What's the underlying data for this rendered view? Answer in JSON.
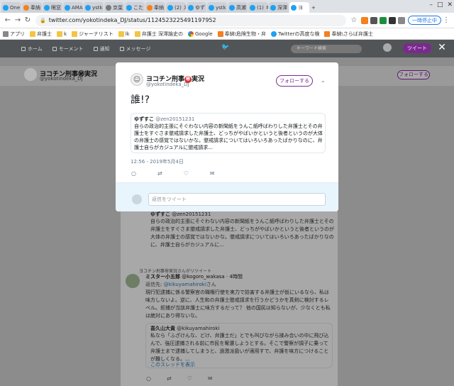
{
  "browser": {
    "tabs": [
      {
        "label": "One",
        "icon": "tw"
      },
      {
        "label": "奉納",
        "icon": "or"
      },
      {
        "label": "眼窓",
        "icon": "tw"
      },
      {
        "label": "AMA",
        "icon": "tw"
      },
      {
        "label": "ystk",
        "icon": "tw"
      },
      {
        "label": "京葉",
        "icon": "gr"
      },
      {
        "label": "こた",
        "icon": "tw"
      },
      {
        "label": "奉納",
        "icon": "or"
      },
      {
        "label": "(2) え",
        "icon": "tw"
      },
      {
        "label": "ゆず",
        "icon": "tw"
      },
      {
        "label": "ystk",
        "icon": "tw"
      },
      {
        "label": "高瀬",
        "icon": "tw"
      },
      {
        "label": "(1) キ",
        "icon": "tw"
      },
      {
        "label": "深澤",
        "icon": "tw"
      },
      {
        "label": "ヨ",
        "icon": "tw"
      }
    ],
    "url": "twitter.com/yokotindeka_DJ/status/1124523225491197952",
    "pause_label": "一時停止中",
    "bookmarks": [
      {
        "label": "アプリ",
        "icon": "lk"
      },
      {
        "label": "弁護士",
        "icon": "folder"
      },
      {
        "label": "k",
        "icon": "folder"
      },
      {
        "label": "ジャーナリスト",
        "icon": "folder"
      },
      {
        "label": "lk",
        "icon": "folder"
      },
      {
        "label": "弁護士 深澤論史の",
        "icon": "folder"
      },
      {
        "label": "Google",
        "icon": "g"
      },
      {
        "label": "奉納\\危険生物・弁",
        "icon": "or"
      },
      {
        "label": "Twitterの高度な検",
        "icon": "tw"
      },
      {
        "label": "奉納\\さらば弁護士",
        "icon": "or"
      }
    ]
  },
  "twitter_nav": {
    "home": "ホーム",
    "moments": "モーメント",
    "notifications": "通知",
    "messages": "メッセージ",
    "search_placeholder": "キーワード検索",
    "tweet_button": "ツイート"
  },
  "profile": {
    "name": "ヨコチン刑事㊙実況",
    "handle": "@yokotindeka_DJ",
    "follow_label": "フォローする"
  },
  "modal": {
    "author_name": "ヨコチン刑事",
    "author_badge": "㊙",
    "author_suffix": "実況",
    "author_handle": "@yokotindeka_DJ",
    "follow_label": "フォローする",
    "tweet_text": "誰!?",
    "quote": {
      "name": "ゆずすこ",
      "handle": "@zen20151231",
      "text": "自らの政治的主張にそぐわない内容の新聞紙をうんこ紙呼ばわりした弁護士とその弁護士をすぐさま懲戒請求した弁護士、どっちがやばいかというと後者というのが大体の弁護士の感覚ではないかな。懲戒請求についてはいろいろあったばかりなのに、弁護士自らがカジュアルに懲戒請求..."
    },
    "timestamp": "12:56 - 2019年5月4日",
    "reply_placeholder": "返信をツイート"
  },
  "timeline": {
    "quote_name": "ゆずすこ",
    "quote_handle": "@zen20151231",
    "quote_text": "自らの政治的主張にそぐわない内容の新聞紙をうんこ紙呼ばわりした弁護士とその弁護士をすぐさま懲戒請求した弁護士、どっちがやばいかというと後者というのが大体の弁護士の感覚ではないかな。懲戒請求についてはいろいろあったばかりなのに、弁護士自らがカジュアルに...",
    "retweet_label": "ヨコチン刑事㊙実況さんがリツイート",
    "author_name": "ミスター小五郎",
    "author_handle": "@kogoro_wakasa",
    "author_time": "4時間",
    "reply_prefix": "返信先:",
    "reply_to": "@kikuyamahiroki",
    "reply_suffix": "さん",
    "body": "現行犯逮捕に係る警察官の職権行使を実力で妨害する弁護士が仮にいるなら、私は味方しないよ。逆に、人生和の弁護士懲戒請求を行うかどうかを真剣に検討するレベル。拒捕が当該弁護士に味方するだって？ 他の国民は知らないが、少なくとも私は絶対にあり得ないな。",
    "quote2_name": "喜久山大貴",
    "quote2_handle": "@kikuyamahiroki",
    "quote2_text": "私なら「ふざけんな、どけ、弁護士だ」とでも叫びながら揉み合いの中に飛び込んで、強圧逮捕される前に市民を奪還しようとする。そこで警察が調子に乗って弁護士まで逮捕してしまうと、過激派扱いが適用すで、弁護を味方につけることが難しくなる。...",
    "thread_link": "このスレッドを表示"
  }
}
